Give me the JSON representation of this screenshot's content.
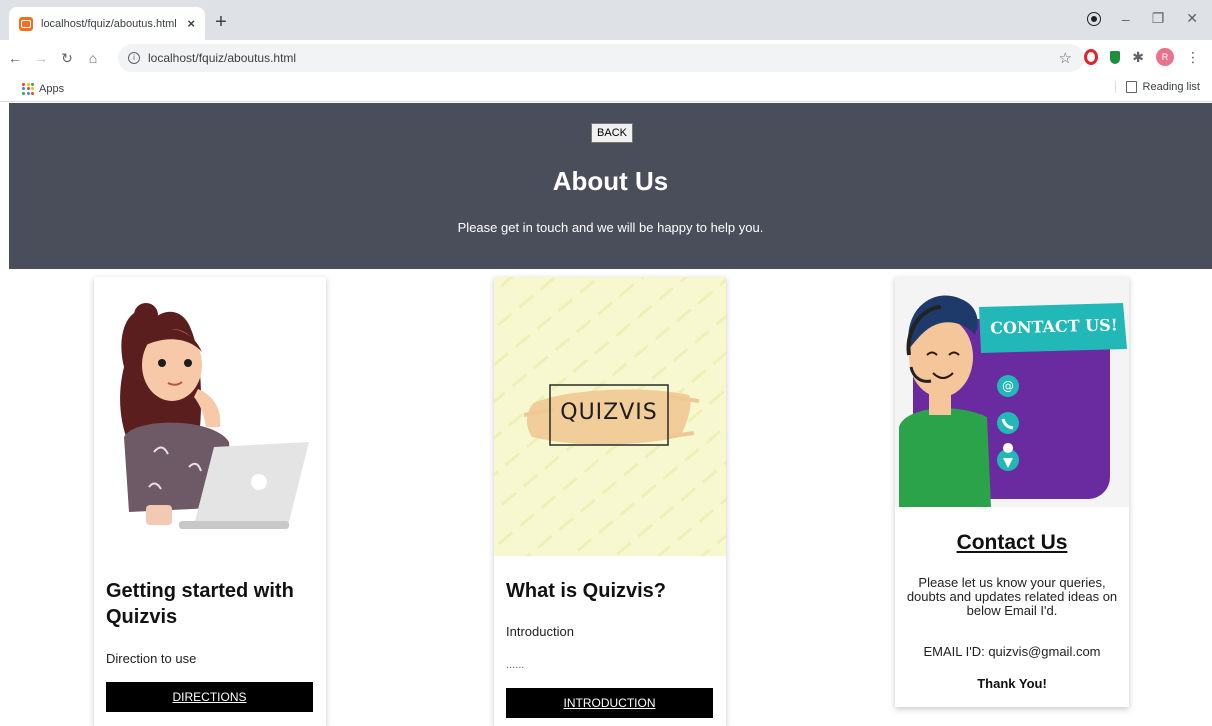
{
  "browser": {
    "tab_title": "localhost/fquiz/aboutus.html",
    "tab_close": "×",
    "new_tab": "+",
    "url": "localhost/fquiz/aboutus.html",
    "bookmarks": {
      "apps_label": "Apps",
      "reading_list_label": "Reading list"
    },
    "profile_initial": "R"
  },
  "hero": {
    "back_label": "BACK",
    "title": "About Us",
    "subtitle": "Please get in touch and we will be happy to help you."
  },
  "cards": [
    {
      "title": "Getting started with Quizvis",
      "text": "Direction to use",
      "button_label": "DIRECTIONS",
      "image_icon": "woman-with-laptop-illustration"
    },
    {
      "title": "What is Quizvis?",
      "text": "Introduction",
      "extra": "......",
      "button_label": "INTRODUCTION",
      "logo_text": "QUIZVIS"
    },
    {
      "title": "Contact Us",
      "body": "Please let us know your queries, doubts and updates related ideas on below Email I'd.",
      "email": "EMAIL I'D: quizvis@gmail.com",
      "thanks": "Thank You!",
      "banner_text": "CONTACT US!",
      "icons": [
        "at-icon",
        "phone-icon",
        "location-icon"
      ]
    }
  ],
  "colors": {
    "hero_bg": "#4a4e5a",
    "button_bg": "#000000",
    "contact_purple": "#6a2aa0",
    "contact_teal": "#22b8b8",
    "quizvis_bg": "#f7f8cf"
  }
}
